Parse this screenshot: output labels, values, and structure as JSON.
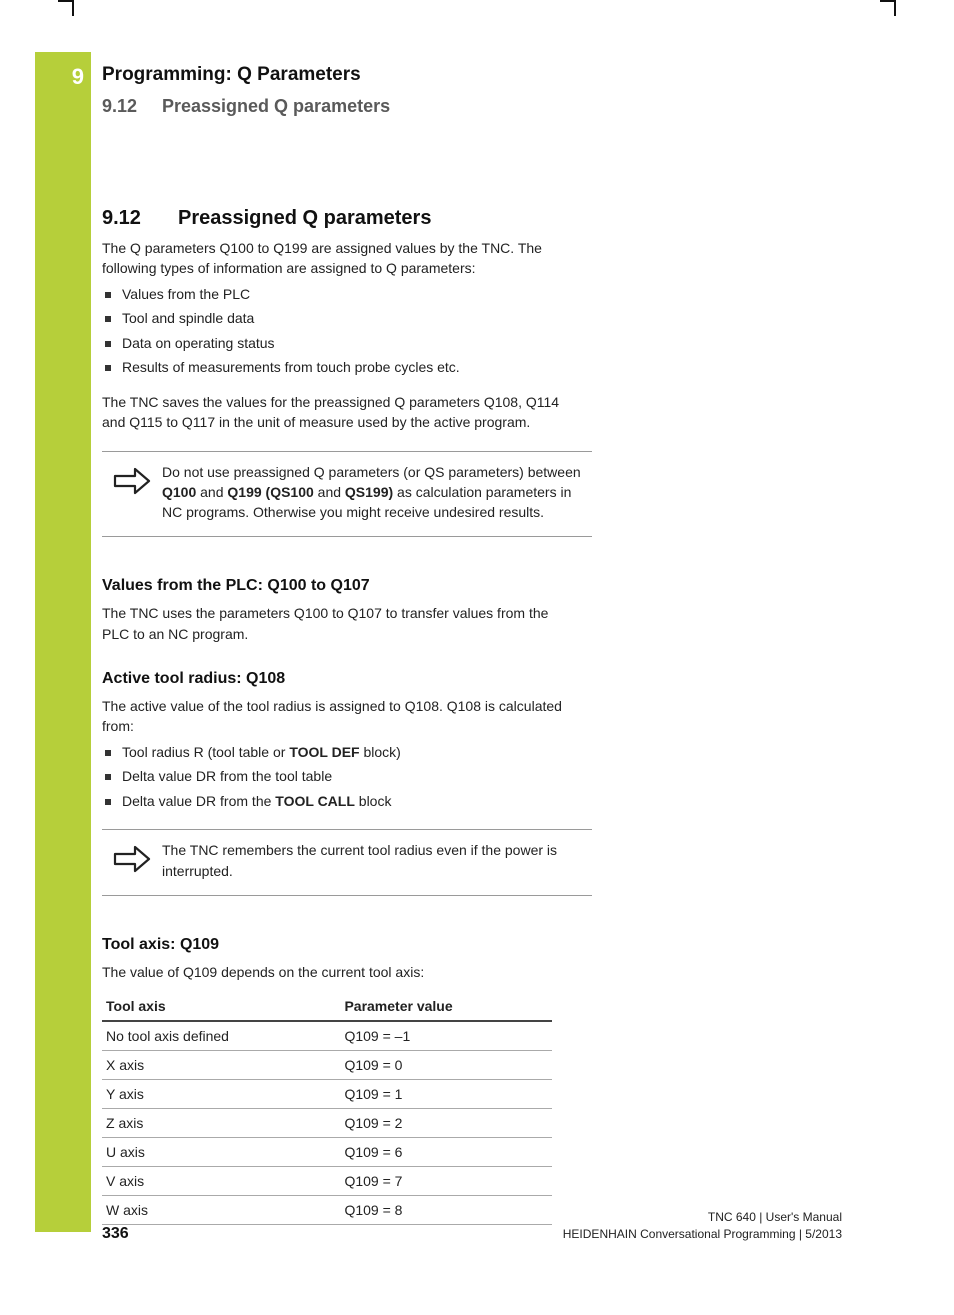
{
  "chapter_number": "9",
  "chapter_title": "Programming: Q Parameters",
  "running_head_number": "9.12",
  "running_head_title": "Preassigned Q parameters",
  "section_number": "9.12",
  "section_title": "Preassigned Q parameters",
  "intro_para": "The Q parameters Q100 to Q199 are assigned values by the TNC. The following types of information are assigned to Q parameters:",
  "intro_bullets": [
    "Values from the PLC",
    "Tool and spindle data",
    "Data on operating status",
    "Results of measurements from touch probe cycles etc."
  ],
  "intro_after": "The TNC saves the values for the preassigned Q parameters Q108, Q114 and Q115 to Q117 in the unit of measure used by the active program.",
  "note1_pre": "Do not use preassigned Q parameters (or QS parameters) between ",
  "note1_b1": "Q100",
  "note1_mid1": " and ",
  "note1_b2": "Q199 (QS100",
  "note1_mid2": " and ",
  "note1_b3": "QS199)",
  "note1_post": " as calculation parameters in NC programs. Otherwise you might receive undesired results.",
  "h_plc": "Values from the PLC: Q100 to Q107",
  "plc_para": "The TNC uses the parameters Q100 to Q107 to transfer values from the PLC to an NC program.",
  "h_radius": "Active tool radius: Q108",
  "radius_para": "The active value of the tool radius is assigned to Q108. Q108 is calculated from:",
  "radius_bullets_pre1": "Tool radius R (tool table or ",
  "radius_bullets_b1": "TOOL DEF",
  "radius_bullets_post1": " block)",
  "radius_bullet2": "Delta value DR from the tool table",
  "radius_bullets_pre3": "Delta value DR from the ",
  "radius_bullets_b3": "TOOL CALL",
  "radius_bullets_post3": " block",
  "note2": "The TNC remembers the current tool radius even if the power is interrupted.",
  "h_axis": "Tool axis: Q109",
  "axis_para": "The value of Q109 depends on the current tool axis:",
  "table": {
    "h1": "Tool axis",
    "h2": "Parameter value",
    "rows": [
      {
        "a": "No tool axis defined",
        "b": "Q109 = –1"
      },
      {
        "a": "X axis",
        "b": "Q109 = 0"
      },
      {
        "a": "Y axis",
        "b": "Q109 = 1"
      },
      {
        "a": "Z axis",
        "b": "Q109 = 2"
      },
      {
        "a": "U axis",
        "b": "Q109 = 6"
      },
      {
        "a": "V axis",
        "b": "Q109 = 7"
      },
      {
        "a": "W axis",
        "b": "Q109 = 8"
      }
    ]
  },
  "footer": {
    "page": "336",
    "line1": "TNC 640 | User's Manual",
    "line2": "HEIDENHAIN Conversational Programming | 5/2013"
  }
}
